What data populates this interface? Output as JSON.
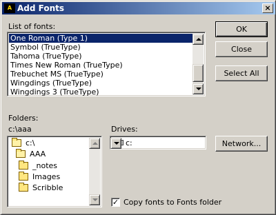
{
  "window": {
    "title": "Add Fonts",
    "close_label": "×"
  },
  "list_of_fonts": {
    "label": "List of fonts:",
    "items": [
      "One Roman (Type 1)",
      "Symbol (TrueType)",
      "Tahoma (TrueType)",
      "Times New Roman (TrueType)",
      "Trebuchet MS (TrueType)",
      "Wingdings (TrueType)",
      "Wingdings 3 (TrueType)"
    ],
    "selected_index": 0
  },
  "buttons": {
    "ok": "OK",
    "close": "Close",
    "select_all": "Select All",
    "network": "Network..."
  },
  "folders": {
    "label": "Folders:",
    "current_path": "c:\\aaa",
    "tree": [
      "c:\\",
      "AAA",
      "_notes",
      "Images",
      "Scribble"
    ]
  },
  "drives": {
    "label": "Drives:",
    "selected": "c:"
  },
  "copy_option": {
    "label": "Copy fonts to Fonts folder",
    "checked": true
  }
}
